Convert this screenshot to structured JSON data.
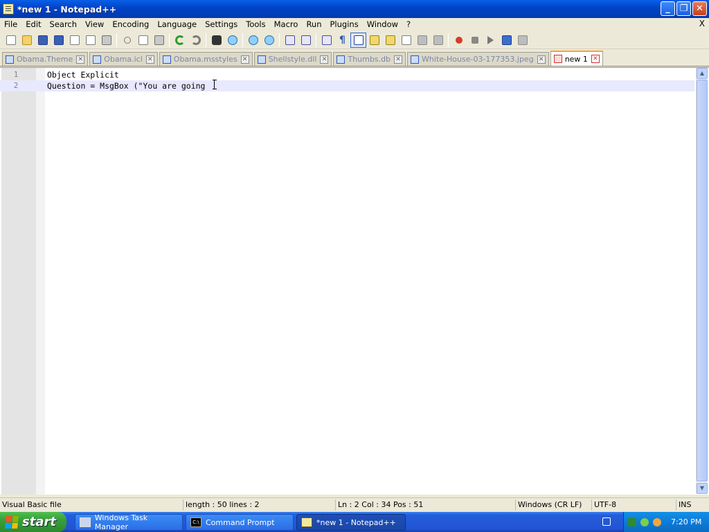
{
  "window": {
    "title": "*new 1 - Notepad++",
    "buttons": {
      "minimize": "_",
      "maximize": "❐",
      "close": "✕"
    }
  },
  "menu": {
    "items": [
      "File",
      "Edit",
      "Search",
      "View",
      "Encoding",
      "Language",
      "Settings",
      "Tools",
      "Macro",
      "Run",
      "Plugins",
      "Window",
      "?"
    ],
    "close": "X"
  },
  "toolbar": {
    "icons": [
      "new-file-icon",
      "open-file-icon",
      "save-icon",
      "save-all-icon",
      "close-icon",
      "close-all-icon",
      "print-icon",
      "cut-icon",
      "copy-icon",
      "paste-icon",
      "undo-icon",
      "redo-icon",
      "find-icon",
      "replace-icon",
      "zoom-in-icon",
      "zoom-out-icon",
      "sync-vertical-icon",
      "sync-horizontal-icon",
      "word-wrap-icon",
      "show-all-chars-icon",
      "indent-guide-icon",
      "user-lang-icon",
      "doc-map-icon",
      "function-list-icon",
      "folder-workspace-icon",
      "monitoring-icon",
      "record-macro-icon",
      "stop-macro-icon",
      "play-macro-icon",
      "run-macro-multiple-icon",
      "save-macro-icon"
    ]
  },
  "tabs": [
    {
      "label": "Obama.Theme",
      "close": "✕"
    },
    {
      "label": "Obama.icl",
      "close": "✕"
    },
    {
      "label": "Obama.msstyles",
      "close": "✕"
    },
    {
      "label": "Shellstyle.dll",
      "close": "✕"
    },
    {
      "label": "Thumbs.db",
      "close": "✕"
    },
    {
      "label": "White-House-03-177353.jpeg",
      "close": "✕"
    },
    {
      "label": "new 1",
      "close": "✕"
    }
  ],
  "editor": {
    "lines": [
      {
        "num": "1",
        "text": "Object Explicit"
      },
      {
        "num": "2",
        "text": "Question = MsgBox (\"You are going"
      }
    ],
    "current_line": 2
  },
  "statusbar": {
    "language": "Visual Basic file",
    "length_lines": "length : 50    lines : 2",
    "position": "Ln : 2    Col : 34    Pos : 51",
    "eol": "Windows (CR LF)",
    "encoding": "UTF-8",
    "mode": "INS"
  },
  "taskbar": {
    "start": "start",
    "tasks": [
      {
        "label": "Windows Task Manager"
      },
      {
        "label": "Command Prompt"
      },
      {
        "label": "*new 1 - Notepad++"
      }
    ],
    "clock": "7:20 PM"
  }
}
